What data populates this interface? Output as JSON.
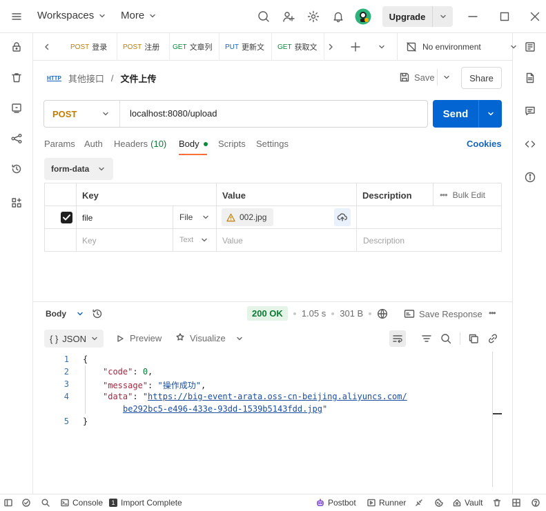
{
  "topbar": {
    "workspaces_label": "Workspaces",
    "more_label": "More",
    "upgrade_label": "Upgrade"
  },
  "tabs": [
    {
      "method": "POST",
      "title": "登录"
    },
    {
      "method": "POST",
      "title": "注册"
    },
    {
      "method": "GET",
      "title": "文章列"
    },
    {
      "method": "PUT",
      "title": "更新文"
    },
    {
      "method": "GET",
      "title": "获取文"
    }
  ],
  "environment": {
    "label": "No environment"
  },
  "breadcrumb": {
    "badge": "HTTP",
    "parent": "其他接口",
    "separator": "/",
    "current": "文件上传"
  },
  "actions": {
    "save_label": "Save",
    "share_label": "Share"
  },
  "request": {
    "method": "POST",
    "url": "localhost:8080/upload",
    "send_label": "Send"
  },
  "request_tabs": {
    "params": "Params",
    "auth": "Auth",
    "headers": "Headers",
    "headers_count": "(10)",
    "body": "Body",
    "scripts": "Scripts",
    "settings": "Settings",
    "cookies": "Cookies"
  },
  "body_mode": "form-data",
  "kv_table": {
    "headers": {
      "key": "Key",
      "value": "Value",
      "description": "Description",
      "bulk_edit": "Bulk Edit"
    },
    "rows": [
      {
        "checked": true,
        "key": "file",
        "type": "File",
        "value": "002.jpg",
        "description": ""
      }
    ],
    "empty_row": {
      "key": "Key",
      "type": "Text",
      "value": "Value",
      "description": "Description"
    }
  },
  "response": {
    "body_label": "Body",
    "status": "200 OK",
    "time": "1.05 s",
    "size": "301 B",
    "save_response_label": "Save Response",
    "format_label": "JSON",
    "preview_label": "Preview",
    "visualize_label": "Visualize",
    "line_numbers": [
      "1",
      "2",
      "3",
      "4",
      "",
      "5"
    ],
    "json": {
      "open": "{",
      "code_key": "\"code\"",
      "code_value": "0",
      "message_key": "\"message\"",
      "message_value": "\"操作成功\"",
      "data_key": "\"data\"",
      "data_value_part1": "https://big-event-arata.oss-cn-beijing.aliyuncs.com/",
      "data_value_part2": "be292bc5-e496-433e-93dd-1539b5143fdd.jpg",
      "close": "}"
    }
  },
  "footer": {
    "console_label": "Console",
    "import_label": "Import Complete",
    "postbot_label": "Postbot",
    "runner_label": "Runner",
    "vault_label": "Vault"
  },
  "colors": {
    "accent_send": "#0265d2",
    "post_method": "#c27c00",
    "get_method": "#0b8a3e",
    "put_method": "#1565c0",
    "status_ok": "#0b7a35",
    "active_tab_underline": "#ff6c37"
  }
}
